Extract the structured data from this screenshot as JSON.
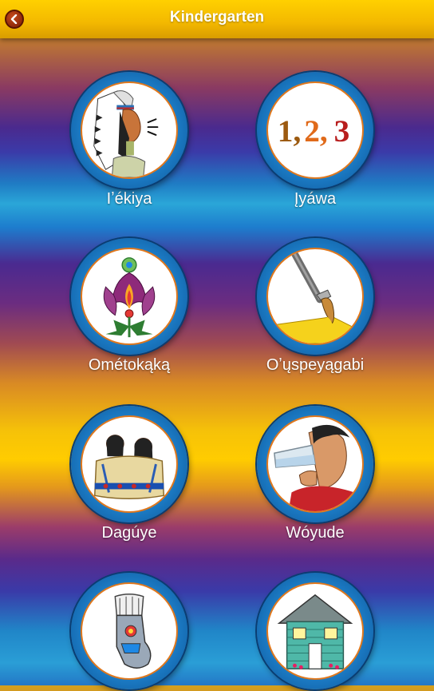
{
  "header": {
    "title": "Kindergarten",
    "back_icon": "chevron-left-icon"
  },
  "tiles": [
    {
      "label": "Iʼékiya",
      "icon": "chief-speaking-icon"
    },
    {
      "label": "Įyáwa",
      "icon": "numbers-icon",
      "numbers": [
        "1,",
        "2,",
        "3"
      ]
    },
    {
      "label": "Ométokąką",
      "icon": "flower-icon"
    },
    {
      "label": "Oʼųspeyągabi",
      "icon": "paintbrush-icon"
    },
    {
      "label": "Dagúye",
      "icon": "family-blanket-icon"
    },
    {
      "label": "Wóyude",
      "icon": "drinking-water-icon"
    },
    {
      "label": "",
      "icon": "moccasin-icon"
    },
    {
      "label": "",
      "icon": "house-icon"
    }
  ],
  "colors": {
    "header": "#f3b800",
    "ring": "#1a77c0",
    "inner_border": "#e0781d"
  }
}
